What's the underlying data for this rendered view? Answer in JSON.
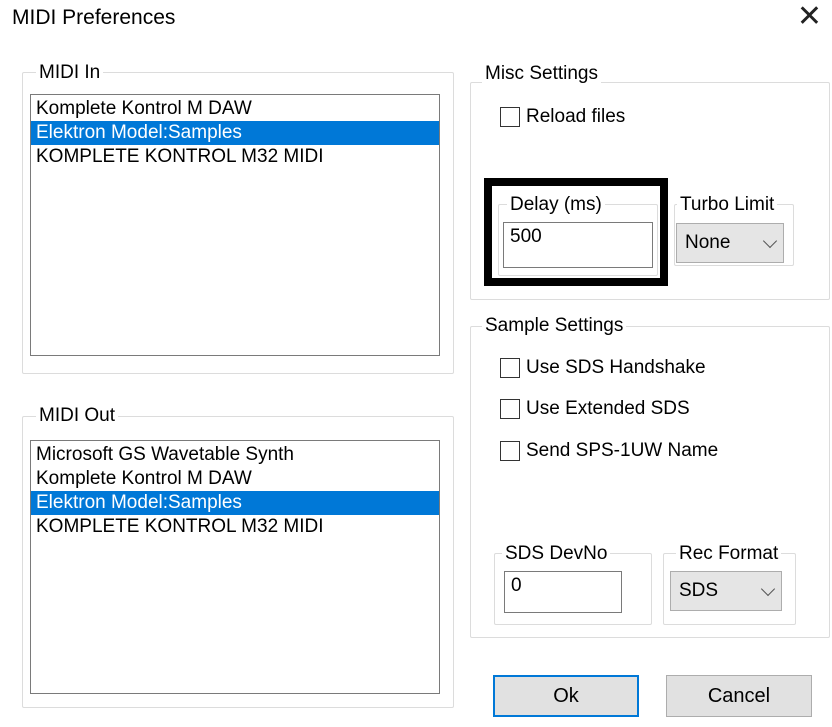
{
  "window": {
    "title": "MIDI Preferences"
  },
  "midi_in": {
    "label": "MIDI In",
    "items": [
      "Komplete Kontrol M DAW",
      "Elektron Model:Samples",
      "KOMPLETE KONTROL M32 MIDI"
    ],
    "selected_index": 1
  },
  "midi_out": {
    "label": "MIDI Out",
    "items": [
      "Microsoft GS Wavetable Synth",
      "Komplete Kontrol M DAW",
      "Elektron Model:Samples",
      "KOMPLETE KONTROL M32 MIDI"
    ],
    "selected_index": 2
  },
  "misc": {
    "label": "Misc Settings",
    "reload_files": {
      "label": "Reload files",
      "checked": false
    },
    "delay": {
      "label": "Delay (ms)",
      "value": "500"
    },
    "turbo": {
      "label": "Turbo Limit",
      "value": "None"
    }
  },
  "sample": {
    "label": "Sample Settings",
    "sds_handshake": {
      "label": "Use SDS Handshake",
      "checked": false
    },
    "extended_sds": {
      "label": "Use Extended SDS",
      "checked": false
    },
    "send_name": {
      "label": "Send SPS-1UW Name",
      "checked": false
    },
    "devno": {
      "label": "SDS DevNo",
      "value": "0"
    },
    "rec_format": {
      "label": "Rec Format",
      "value": "SDS"
    }
  },
  "buttons": {
    "ok": "Ok",
    "cancel": "Cancel"
  },
  "colors": {
    "selection": "#0078d7",
    "highlight_box": "#000000"
  }
}
